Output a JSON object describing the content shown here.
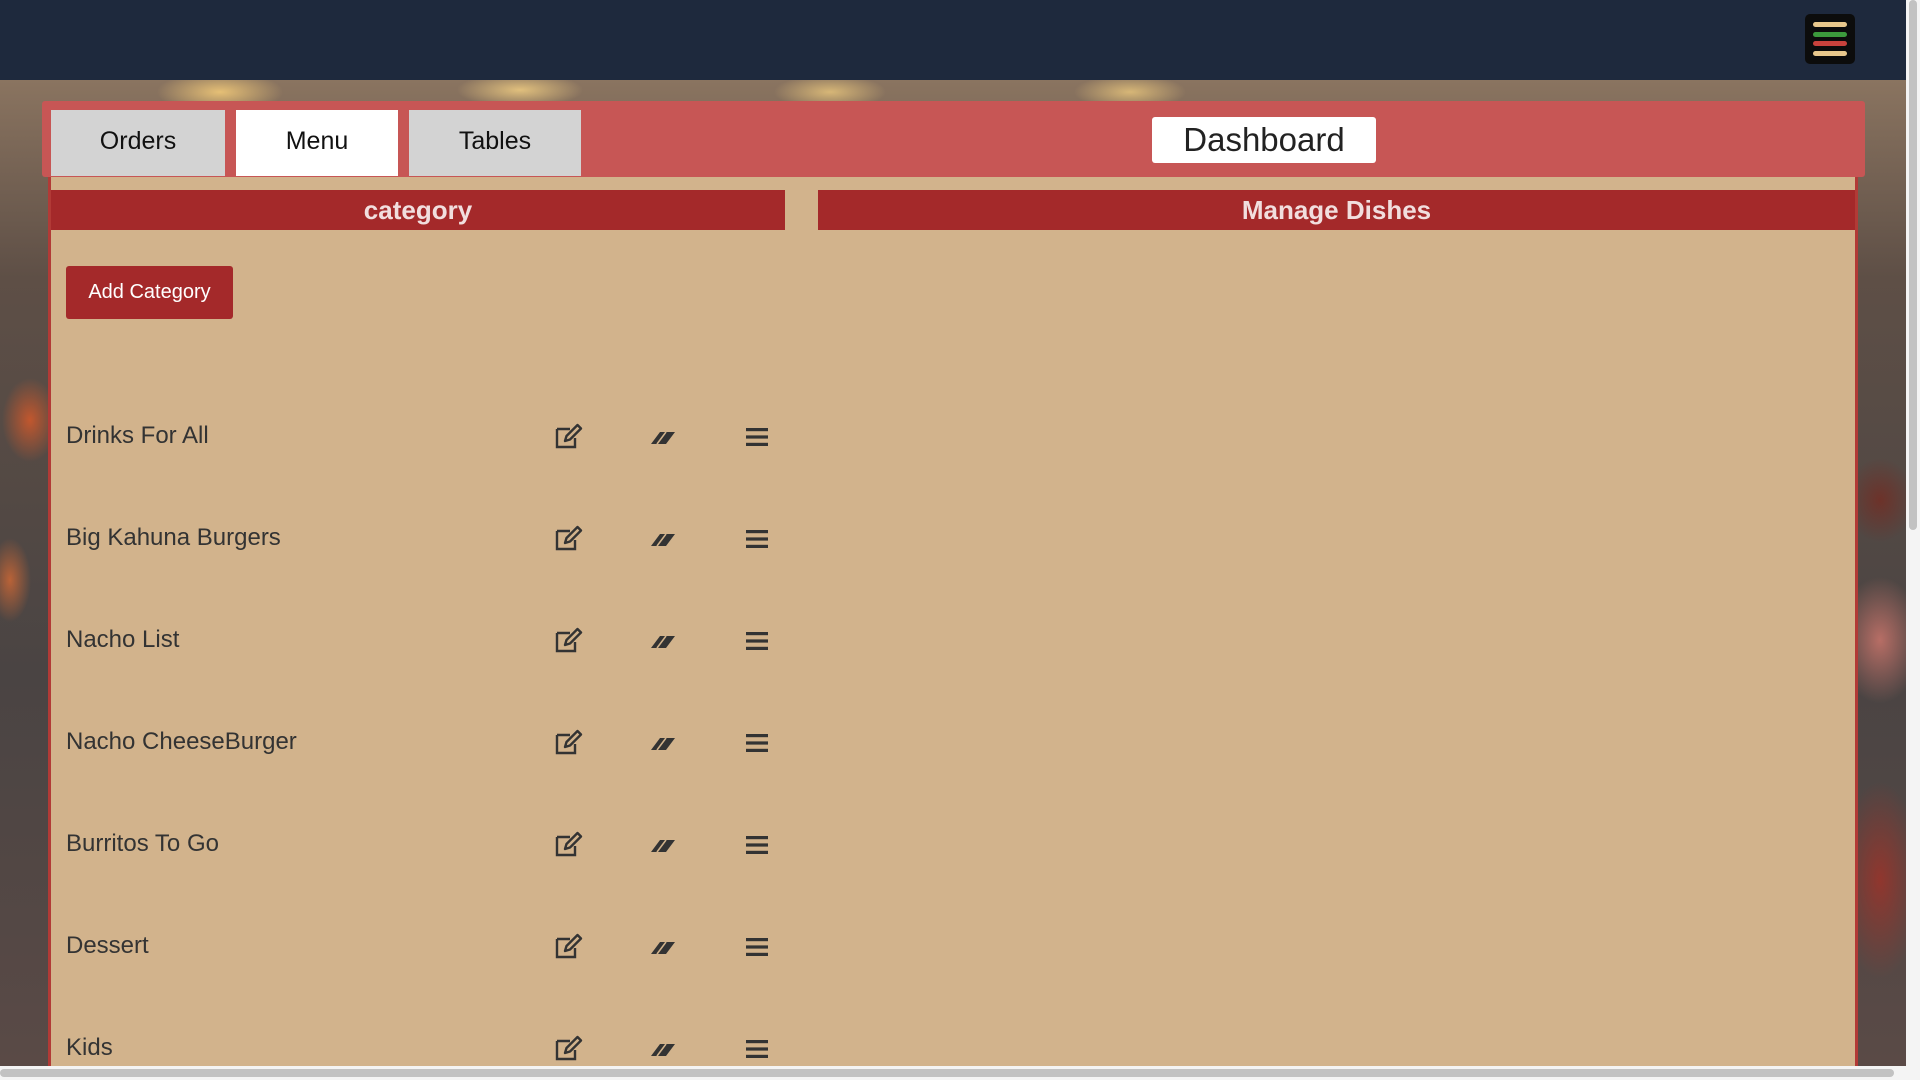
{
  "header": {
    "menu_icon": "hamburger-icon",
    "menu_icon_colors": [
      "#e9c88c",
      "#3c9a3c",
      "#c9423c",
      "#e9c88c"
    ]
  },
  "tabs": [
    {
      "label": "Orders",
      "active": false
    },
    {
      "label": "Menu",
      "active": true
    },
    {
      "label": "Tables",
      "active": false
    }
  ],
  "dashboard_title": "Dashboard",
  "category_panel": {
    "title": "category",
    "add_button_label": "Add Category",
    "categories": [
      {
        "name": "Drinks For All"
      },
      {
        "name": "Big Kahuna Burgers"
      },
      {
        "name": "Nacho List"
      },
      {
        "name": "Nacho CheeseBurger"
      },
      {
        "name": "Burritos To Go"
      },
      {
        "name": "Dessert"
      },
      {
        "name": "Kids"
      }
    ],
    "row_icons": [
      "edit-icon",
      "eraser-icon",
      "list-icon"
    ]
  },
  "dishes_panel": {
    "title": "Manage Dishes"
  },
  "colors": {
    "topbar": "#1e293d",
    "tabbar": "#c75655",
    "panel_header": "#a4292a",
    "content_bg": "#d2b38c"
  }
}
